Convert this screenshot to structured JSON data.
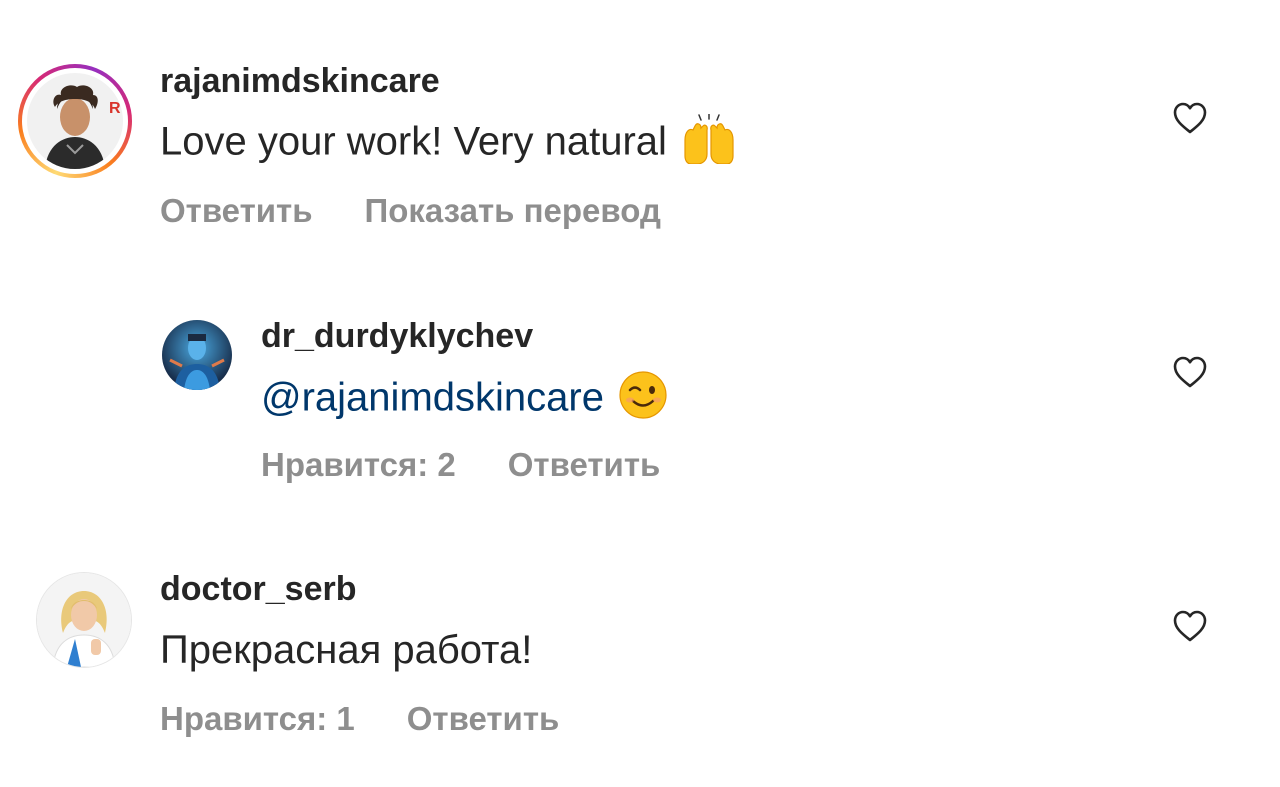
{
  "comments": [
    {
      "username": "rajanimdskincare",
      "text": "Love your work! Very natural",
      "emoji": "raising-hands",
      "actions": {
        "reply": "Ответить",
        "translate": "Показать перевод"
      },
      "avatar_ring": "story-gradient"
    },
    {
      "username": "dr_durdyklychev",
      "mention": "@rajanimdskincare",
      "emoji": "winking-face",
      "actions": {
        "likes": "Нравится: 2",
        "reply": "Ответить"
      },
      "is_reply": true
    },
    {
      "username": "doctor_serb",
      "text": "Прекрасная работа!",
      "actions": {
        "likes": "Нравится: 1",
        "reply": "Ответить"
      }
    }
  ],
  "colors": {
    "text": "#262626",
    "secondary": "#8e8e8e",
    "mention": "#00376b",
    "background": "#ffffff"
  },
  "icons": [
    "heart-outline-icon",
    "raising-hands-emoji",
    "winking-face-emoji"
  ]
}
